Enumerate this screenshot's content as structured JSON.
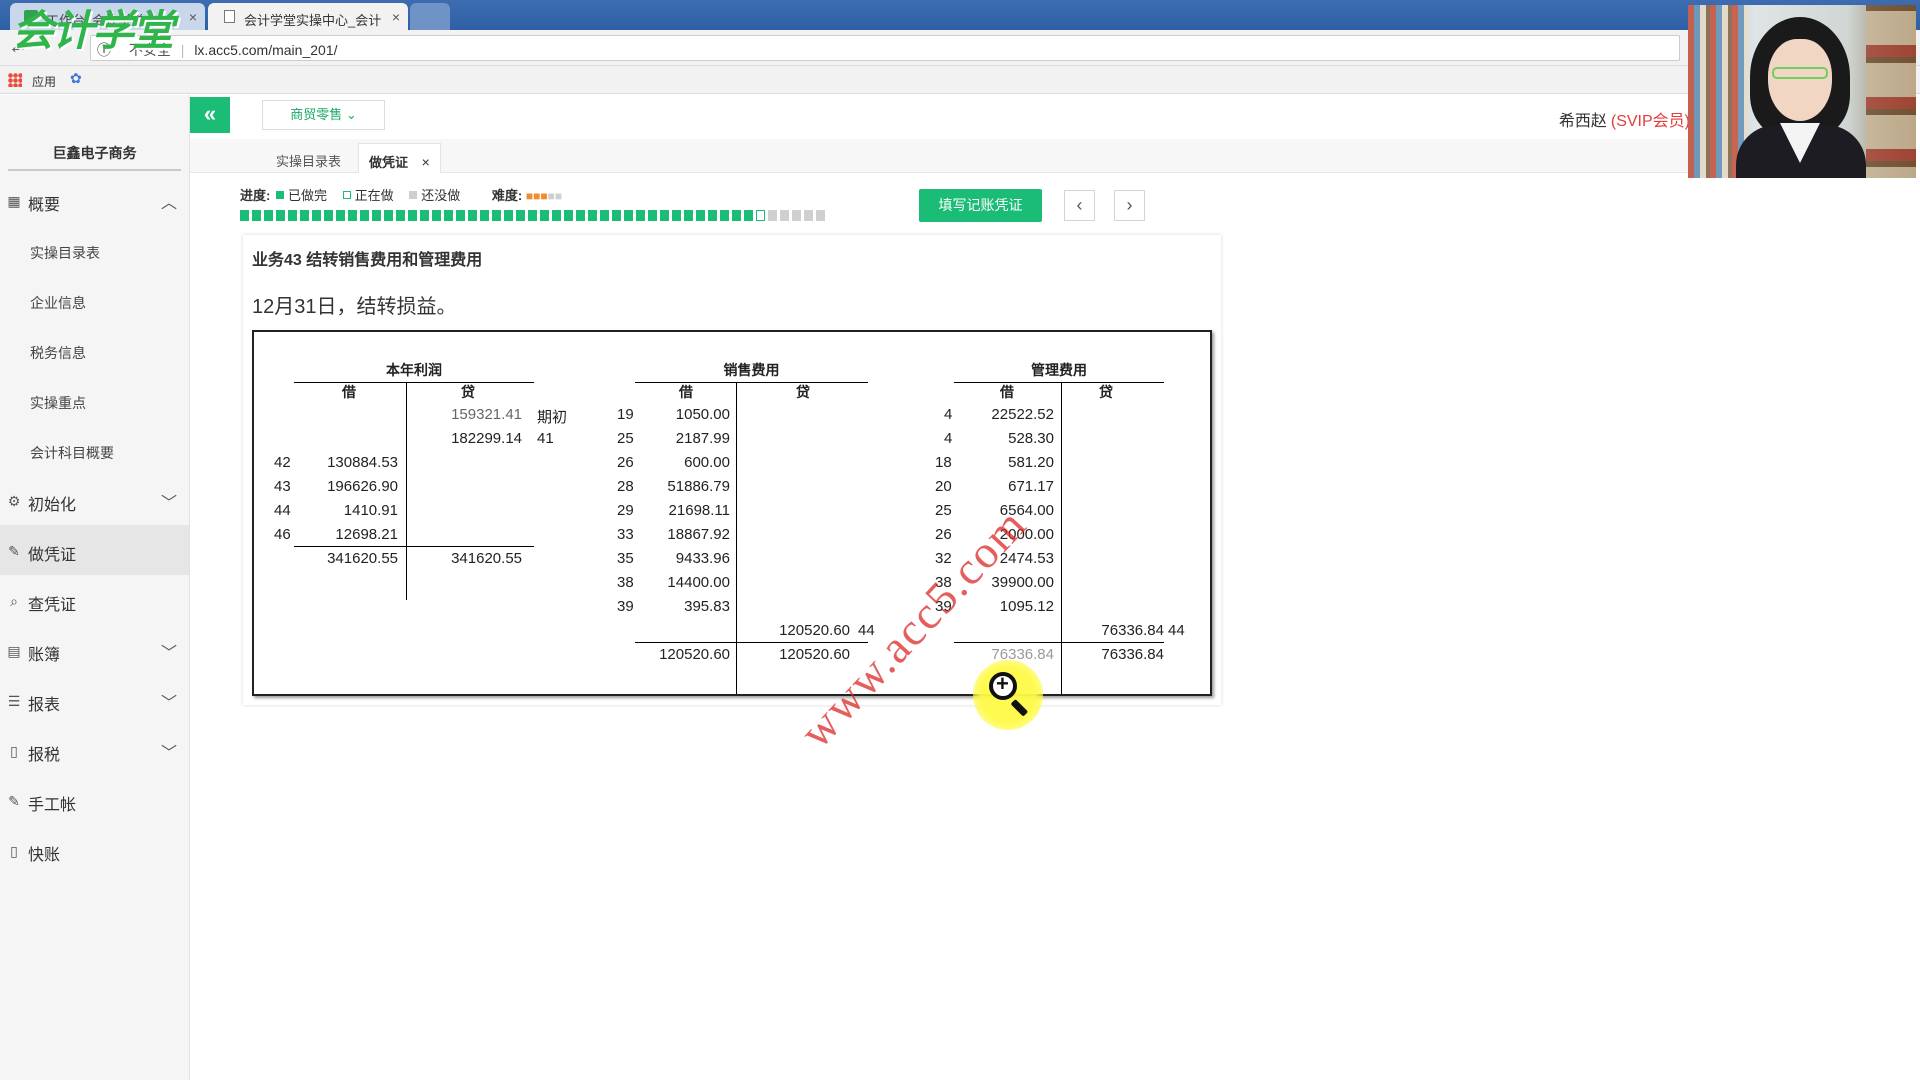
{
  "browser": {
    "tabs": [
      {
        "title": "工作台_会计学堂"
      },
      {
        "title": "会计学堂实操中心_会计"
      }
    ],
    "address": {
      "security_label": "不安全",
      "url": "lx.acc5.com/main_201/"
    },
    "bookmarks": {
      "apps_label": "应用"
    },
    "logo_text": "会计学堂"
  },
  "sidebar": {
    "company": "巨鑫电子商务",
    "overview": {
      "label": "概要"
    },
    "sub_items": [
      "实操目录表",
      "企业信息",
      "税务信息",
      "实操重点",
      "会计科目概要"
    ],
    "items": [
      {
        "label": "初始化"
      },
      {
        "label": "做凭证"
      },
      {
        "label": "查凭证"
      },
      {
        "label": "账簿"
      },
      {
        "label": "报表"
      },
      {
        "label": "报税"
      },
      {
        "label": "手工帐"
      },
      {
        "label": "快账"
      }
    ]
  },
  "topbar": {
    "industry_dropdown": "商贸零售",
    "user_name": "希西赵",
    "user_badge": "(SVIP会员)"
  },
  "page_tabs": [
    {
      "label": "实操目录表"
    },
    {
      "label": "做凭证"
    }
  ],
  "progress": {
    "label": "进度:",
    "legend_done": "已做完",
    "legend_doing": "正在做",
    "legend_todo": "还没做",
    "difficulty_label": "难度:",
    "difficulty_stars": 3,
    "difficulty_max": 5,
    "done_count": 43,
    "current": 44,
    "total": 49
  },
  "actions": {
    "fill_voucher": "填写记账凭证",
    "prev": "‹",
    "next": "›"
  },
  "task": {
    "title": "业务43 结转销售费用和管理费用",
    "description": "12月31日，结转损益。"
  },
  "ledger": {
    "debit_label": "借",
    "credit_label": "贷",
    "accounts": [
      {
        "name": "本年利润",
        "credit_rows": [
          {
            "amount": "159321.41",
            "ref": "期初"
          },
          {
            "amount": "182299.14",
            "ref": "41"
          }
        ],
        "debit_rows": [
          {
            "ref": "42",
            "amount": "130884.53"
          },
          {
            "ref": "43",
            "amount": "196626.90"
          },
          {
            "ref": "44",
            "amount": "1410.91"
          },
          {
            "ref": "46",
            "amount": "12698.21"
          }
        ],
        "total_debit": "341620.55",
        "total_credit": "341620.55"
      },
      {
        "name": "销售费用",
        "debit_rows": [
          {
            "ref": "19",
            "amount": "1050.00"
          },
          {
            "ref": "25",
            "amount": "2187.99"
          },
          {
            "ref": "26",
            "amount": "600.00"
          },
          {
            "ref": "28",
            "amount": "51886.79"
          },
          {
            "ref": "29",
            "amount": "21698.11"
          },
          {
            "ref": "33",
            "amount": "18867.92"
          },
          {
            "ref": "35",
            "amount": "9433.96"
          },
          {
            "ref": "38",
            "amount": "14400.00"
          },
          {
            "ref": "39",
            "amount": "395.83"
          }
        ],
        "credit_rows": [
          {
            "amount": "120520.60",
            "ref": "44"
          }
        ],
        "total_debit": "120520.60",
        "total_credit": "120520.60"
      },
      {
        "name": "管理费用",
        "debit_rows": [
          {
            "ref": "4",
            "amount": "22522.52"
          },
          {
            "ref": "4",
            "amount": "528.30"
          },
          {
            "ref": "18",
            "amount": "581.20"
          },
          {
            "ref": "20",
            "amount": "671.17"
          },
          {
            "ref": "25",
            "amount": "6564.00"
          },
          {
            "ref": "26",
            "amount": "2000.00"
          },
          {
            "ref": "32",
            "amount": "2474.53"
          },
          {
            "ref": "38",
            "amount": "39900.00"
          },
          {
            "ref": "39",
            "amount": "1095.12"
          }
        ],
        "credit_rows": [
          {
            "amount": "76336.84",
            "ref": "44"
          }
        ],
        "total_debit": "76336.84",
        "total_credit": "76336.84"
      }
    ],
    "watermark": "www.acc5.com"
  },
  "colors": {
    "accent_green": "#1bbc76",
    "vip_red": "#e23c3c",
    "watermark_red": "#dc2828",
    "star_orange": "#f08b2e"
  },
  "icons": [
    "back-arrow-icon",
    "apps-grid-icon",
    "paw-icon",
    "overview-icon",
    "settings-icon",
    "pen-icon",
    "search-icon",
    "book-icon",
    "report-icon",
    "file-icon",
    "zoom-in-icon"
  ]
}
